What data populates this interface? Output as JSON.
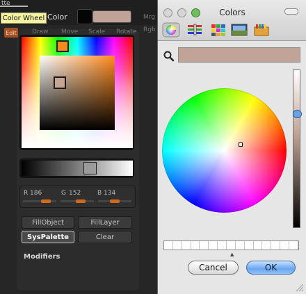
{
  "left_panel": {
    "top_label_fragment": "tte",
    "tooltip": "Color Wheel",
    "edit_label": "Edit",
    "color_label": "Color",
    "tabs": [
      "Draw",
      "Move",
      "Scale",
      "Rotate"
    ],
    "right_fragments": [
      "Mrg",
      "Rgb"
    ],
    "rgb": {
      "r_label": "R",
      "r_value": "186",
      "g_label": "G",
      "g_value": "152",
      "b_label": "B",
      "b_value": "134"
    },
    "buttons": [
      "FillObject",
      "FillLayer",
      "SysPalette",
      "Clear"
    ],
    "modifiers_label": "Modifiers",
    "colors": {
      "swatch": "#c0a396",
      "accent": "#f28a1c"
    }
  },
  "colors_window": {
    "title": "Colors",
    "tool_icons": [
      "color-wheel-icon",
      "color-sliders-icon",
      "color-palettes-icon",
      "image-palettes-icon",
      "crayons-icon"
    ],
    "search_icon": "magnifier-icon",
    "selected_color_hex": "#c2a397",
    "cancel_label": "Cancel",
    "ok_label": "OK"
  }
}
